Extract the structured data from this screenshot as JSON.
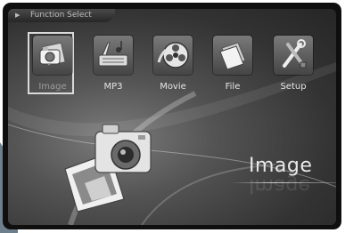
{
  "header": {
    "title": "Function Select"
  },
  "menu": [
    {
      "id": "image",
      "label": "Image",
      "icon": "image-icon",
      "selected": true
    },
    {
      "id": "mp3",
      "label": "MP3",
      "icon": "music-icon",
      "selected": false
    },
    {
      "id": "movie",
      "label": "Movie",
      "icon": "film-reel-icon",
      "selected": false
    },
    {
      "id": "file",
      "label": "File",
      "icon": "file-icon",
      "selected": false
    },
    {
      "id": "setup",
      "label": "Setup",
      "icon": "tools-icon",
      "selected": false
    }
  ],
  "main": {
    "current_mode": "Image"
  },
  "colors": {
    "background": "#3a3a3a",
    "selection_frame": "#dadada",
    "text": "#e6e6e6"
  }
}
